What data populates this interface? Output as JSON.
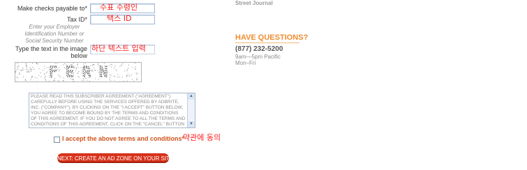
{
  "form": {
    "payable_label": "Make checks payable to*",
    "payable_value": "",
    "taxid_label": "Tax ID*",
    "taxid_value": "",
    "taxid_hint": "Enter your Employer Identification Number or Social Security Number",
    "captcha_label": "Type the text in the image below",
    "captcha_text": "F E R N",
    "captcha_value": "",
    "agreement_text": "PLEASE READ THIS SUBSCRIBER AGREEMENT (\"AGREEMENT\") CAREFULLY BEFORE USING THE SERVICES OFFERED BY ADBRITE, INC. (\"COMPANY\"). BY CLICKING ON THE \"I ACCEPT\" BUTTON BELOW, YOU AGREE TO BECOME BOUND BY THE TERMS AND CONDITIONS OF THIS AGREEMENT. IF YOU DO NOT AGREE TO ALL THE TERMS AND CONDITIONS OF THIS AGREEMENT, CLICK ON THE \"CANCEL\" BUTTON",
    "accept_label": "I accept the above terms and conditions*",
    "next_button_label": "NEXT: CREATE AN AD ZONE ON YOUR SITE"
  },
  "annotations": {
    "payable": "수표 수령인",
    "taxid": "택스 ID",
    "captcha": "하단 텍스트 입력",
    "accept": "약관에 동의"
  },
  "sidebar": {
    "partial_text": "Street Journal",
    "questions_title": "HAVE QUESTIONS?",
    "phone": "(877) 232-5200",
    "hours_line1": "9am—5pm Pacific",
    "hours_line2": "Mon–Fri"
  },
  "colors": {
    "accent_orange": "#f08c2e",
    "button_red": "#d8321b",
    "annotation_red": "#ff1a1a"
  }
}
